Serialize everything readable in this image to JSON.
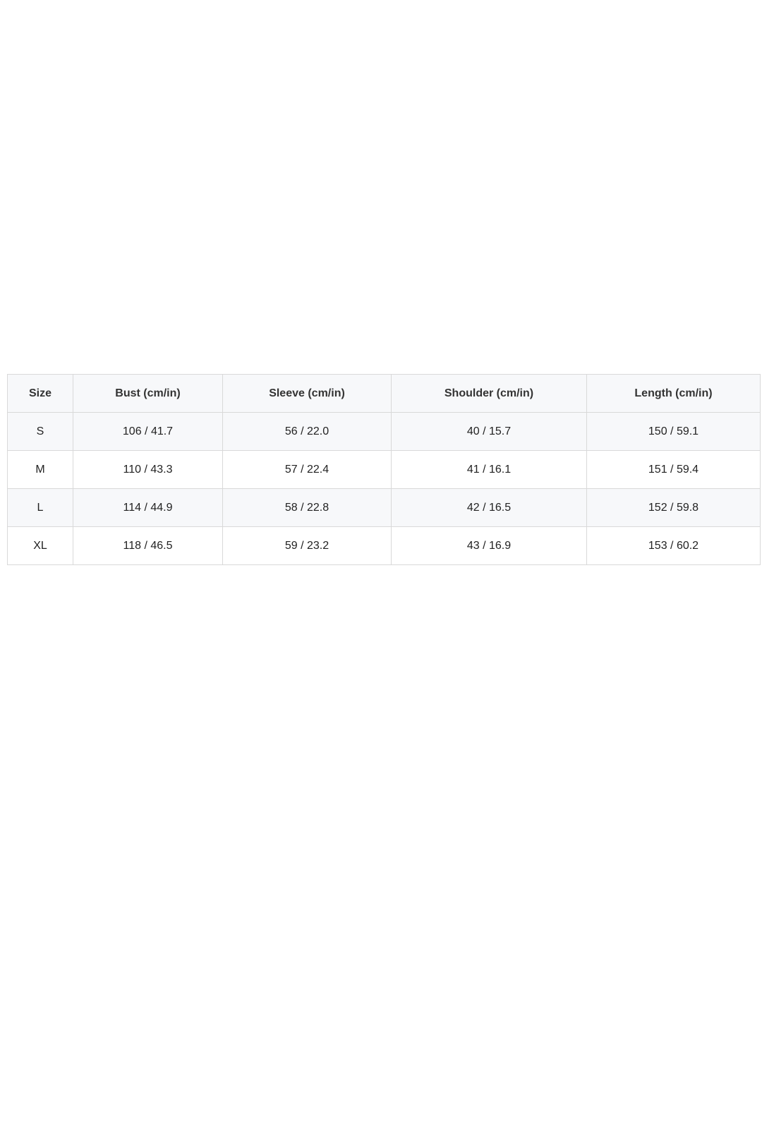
{
  "size_table": {
    "headers": [
      "Size",
      "Bust (cm/in)",
      "Sleeve (cm/in)",
      "Shoulder (cm/in)",
      "Length (cm/in)"
    ],
    "rows": [
      [
        "S",
        "106 / 41.7",
        "56 / 22.0",
        "40 / 15.7",
        "150 / 59.1"
      ],
      [
        "M",
        "110 / 43.3",
        "57 / 22.4",
        "41 / 16.1",
        "151 / 59.4"
      ],
      [
        "L",
        "114 / 44.9",
        "58 / 22.8",
        "42 / 16.5",
        "152 / 59.8"
      ],
      [
        "XL",
        "118 / 46.5",
        "59 / 23.2",
        "43 / 16.9",
        "153 / 60.2"
      ]
    ]
  },
  "colors": {
    "border": "#d9d9d9",
    "header_bg": "#f7f8fa",
    "stripe_bg": "#f7f8fa",
    "text": "#222222"
  }
}
